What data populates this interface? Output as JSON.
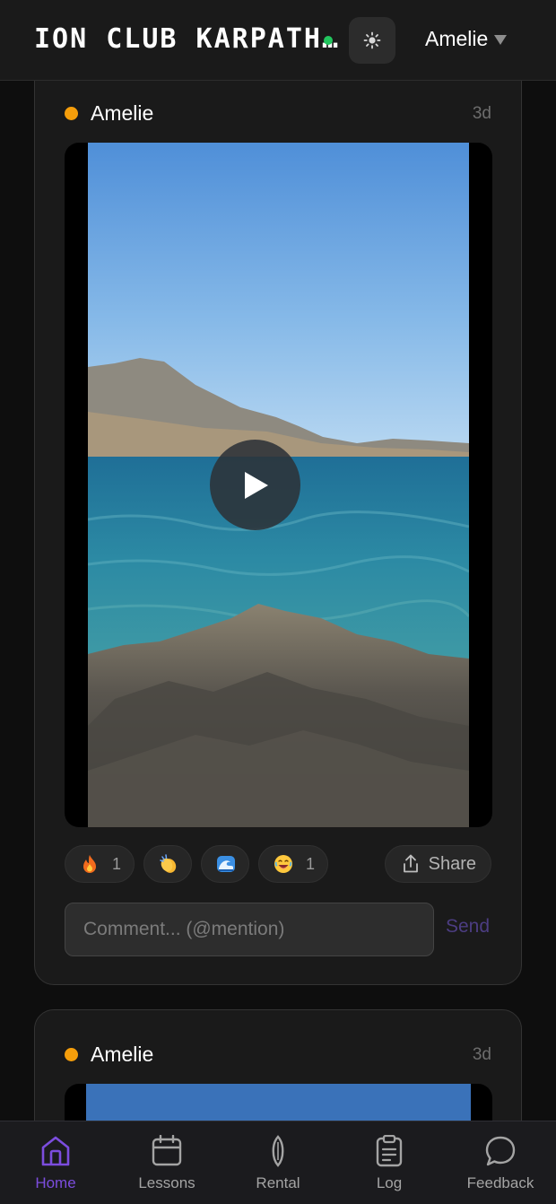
{
  "header": {
    "title": "ION CLUB KARPATH…",
    "status": "online",
    "theme_icon": "sun-icon",
    "user_name": "Amelie"
  },
  "posts": [
    {
      "author": "Amelie",
      "time": "3d",
      "media": "video",
      "reactions": [
        {
          "icon": "fire-emoji",
          "count": "1"
        },
        {
          "icon": "clapping-hands-emoji",
          "count": ""
        },
        {
          "icon": "wave-emoji",
          "count": ""
        },
        {
          "icon": "laughing-face-emoji",
          "count": "1"
        }
      ],
      "share_label": "Share",
      "comment_placeholder": "Comment... (@mention)",
      "send_label": "Send"
    },
    {
      "author": "Amelie",
      "time": "3d",
      "media": "image"
    }
  ],
  "nav": {
    "items": [
      {
        "label": "Home",
        "icon": "home-icon",
        "active": true
      },
      {
        "label": "Lessons",
        "icon": "calendar-icon",
        "active": false
      },
      {
        "label": "Rental",
        "icon": "board-icon",
        "active": false
      },
      {
        "label": "Log",
        "icon": "clipboard-icon",
        "active": false
      },
      {
        "label": "Feedback",
        "icon": "chat-bubble-icon",
        "active": false
      }
    ]
  },
  "colors": {
    "accent": "#7c4dde",
    "online": "#22c55e",
    "author_dot": "#f59e0b",
    "send": "#4c3d82"
  }
}
